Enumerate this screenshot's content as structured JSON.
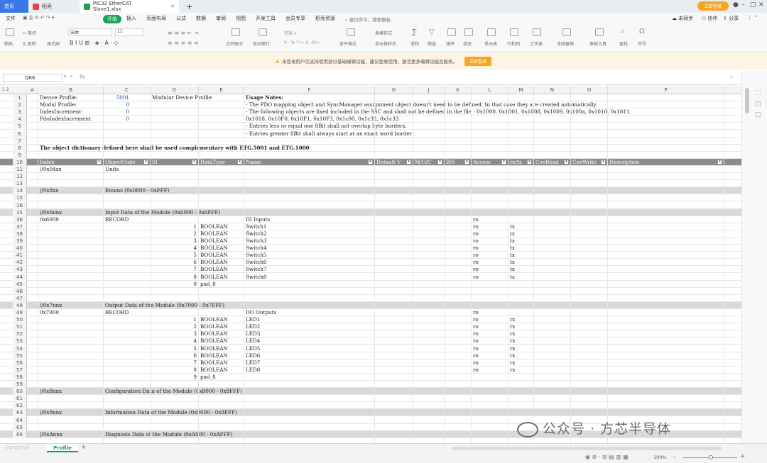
{
  "tabs": {
    "home": "首页",
    "daoke": "稻壳",
    "file": "PIC32 EtherCAT Slave1.xlsx",
    "login": "立即登录"
  },
  "menu": {
    "file": "文件",
    "start": "开始",
    "insert": "插入",
    "page_layout": "页面布局",
    "formula": "公式",
    "data": "数据",
    "review": "审阅",
    "view": "视图",
    "dev_tools": "开发工具",
    "member": "会员专享",
    "resources": "稻壳资源",
    "search": "查找命令、搜索模板",
    "unsynced": "未同步",
    "collab": "协作",
    "share": "分享"
  },
  "ribbon": {
    "paste": "粘贴",
    "cut": "剪切",
    "copy": "复制",
    "format_painter": "格式刷",
    "font": "宋体",
    "font_size": "11",
    "merge_center": "合并居中",
    "auto_wrap": "自动换行",
    "cond_format": "条件格式",
    "table_style": "表格样式",
    "cell_style": "单元格样式",
    "sum": "求和",
    "filter": "筛选",
    "sort": "排序",
    "fill": "填充",
    "cell": "单元格",
    "rowcol": "行和列",
    "worksheet": "工作表",
    "freeze": "冻结窗格",
    "table_tools": "表格工具",
    "find": "查找",
    "symbol": "符号"
  },
  "notice": {
    "text": "未登录用户仅支持使用部分基础编辑功能，建议登录使用，激活更多编辑功能及服务。",
    "button": "立即登录"
  },
  "formula_bar": {
    "name_box": "Q66",
    "fx": "fx"
  },
  "columns": [
    "A",
    "B",
    "C",
    "D",
    "E",
    "F",
    "G",
    "J",
    "K",
    "L",
    "M",
    "N",
    "O",
    "P"
  ],
  "rows": [
    {
      "n": "1",
      "c": {
        "B": "Device Profile:",
        "C": "5001",
        "D": "Modular Device Profile",
        "F": "Usage Notes:"
      }
    },
    {
      "n": "2",
      "c": {
        "B": "Modul Profile:",
        "C": "0",
        "F": "- The PDO mapping object and SyncManager assignment object doesn't need to be defined. In that case they are created automatically."
      }
    },
    {
      "n": "3",
      "c": {
        "B": "IndexIncrement:",
        "C": "0",
        "F": "- The following objects are fixed included in the SSC and shall not be defined in the file : 0x1000, 0x1001, 0x1008, 0x1009, 0x100a, 0x1010, 0x1011,"
      }
    },
    {
      "n": "4",
      "c": {
        "B": "PdoIndexIncrement:",
        "C": "0",
        "F": "0x1018, 0x10F0, 0x10F1, 0x10F3, 0x1c00, 0x1c32, 0x1c33"
      }
    },
    {
      "n": "5",
      "c": {
        "F": "- Entries less or equal one 8Bit shall not overlap byte borders."
      }
    },
    {
      "n": "6",
      "c": {
        "F": "- Entries greater 8Bit shall always start at an exact word border"
      }
    },
    {
      "n": "7",
      "c": {}
    },
    {
      "n": "8",
      "c": {
        "B": "The object dictionary defined here shall be used complementary with ETG.5001 and ETG.1000"
      }
    },
    {
      "n": "9",
      "c": {}
    },
    {
      "n": "10",
      "hdr": true,
      "c": {
        "B": "Index",
        "C": "ObjectCode",
        "D": "SI",
        "E": "DataType",
        "F": "Name",
        "G": "Default V",
        "J": "M/O/C",
        "K": "B/S",
        "L": "Access",
        "M": "rx/tx",
        "N": "CoeRead",
        "O": "CoeWrite",
        "P": "Description"
      }
    },
    {
      "n": "11",
      "c": {
        "B": "//0x04xx",
        "C": "Units"
      }
    },
    {
      "n": "12",
      "c": {}
    },
    {
      "n": "13",
      "c": {}
    },
    {
      "n": "14",
      "band": true,
      "c": {
        "B": "//0x8xx",
        "C": "Enums (0x0800 - 0xFFF)"
      }
    },
    {
      "n": "15",
      "c": {}
    },
    {
      "n": "16",
      "c": {}
    },
    {
      "n": "35",
      "band": true,
      "c": {
        "B": "//0x6nnx",
        "C": "Input Data of the Module (0x6000 - 0x6FFF)"
      }
    },
    {
      "n": "36",
      "c": {
        "B": "0x6000",
        "C": "RECORD",
        "F": "DI Inputs",
        "L": "ro"
      }
    },
    {
      "n": "37",
      "c": {
        "D": "1",
        "E": "BOOLEAN",
        "F": "Switch1",
        "L": "ro",
        "M": "tx"
      }
    },
    {
      "n": "38",
      "c": {
        "D": "2",
        "E": "BOOLEAN",
        "F": "Switch2",
        "L": "ro",
        "M": "tx"
      }
    },
    {
      "n": "39",
      "c": {
        "D": "3",
        "E": "BOOLEAN",
        "F": "Switch3",
        "L": "ro",
        "M": "tx"
      }
    },
    {
      "n": "40",
      "c": {
        "D": "4",
        "E": "BOOLEAN",
        "F": "Switch4",
        "L": "ro",
        "M": "tx"
      }
    },
    {
      "n": "41",
      "c": {
        "D": "5",
        "E": "BOOLEAN",
        "F": "Switch5",
        "L": "ro",
        "M": "tx"
      }
    },
    {
      "n": "42",
      "c": {
        "D": "6",
        "E": "BOOLEAN",
        "F": "Switch6",
        "L": "ro",
        "M": "tx"
      }
    },
    {
      "n": "43",
      "c": {
        "D": "7",
        "E": "BOOLEAN",
        "F": "Switch7",
        "L": "ro",
        "M": "tx"
      }
    },
    {
      "n": "44",
      "c": {
        "D": "8",
        "E": "BOOLEAN",
        "F": "Switch8",
        "L": "ro",
        "M": "tx"
      }
    },
    {
      "n": "45",
      "c": {
        "D": "9",
        "E": "pad_8"
      }
    },
    {
      "n": "46",
      "c": {}
    },
    {
      "n": "47",
      "c": {}
    },
    {
      "n": "48",
      "band": true,
      "c": {
        "B": "//0x7nnx",
        "C": "Output Data of the Module (0x7000 - 0x7FFF)"
      }
    },
    {
      "n": "49",
      "c": {
        "B": "0x7000",
        "C": "RECORD",
        "F": "DO Outputs",
        "L": "ro"
      }
    },
    {
      "n": "50",
      "c": {
        "D": "1",
        "E": "BOOLEAN",
        "F": "LED1",
        "L": "ro",
        "M": "rx"
      }
    },
    {
      "n": "51",
      "c": {
        "D": "2",
        "E": "BOOLEAN",
        "F": "LED2",
        "L": "ro",
        "M": "rx"
      }
    },
    {
      "n": "52",
      "c": {
        "D": "3",
        "E": "BOOLEAN",
        "F": "LED3",
        "L": "ro",
        "M": "rx"
      }
    },
    {
      "n": "53",
      "c": {
        "D": "4",
        "E": "BOOLEAN",
        "F": "LED4",
        "L": "ro",
        "M": "rx"
      }
    },
    {
      "n": "54",
      "c": {
        "D": "5",
        "E": "BOOLEAN",
        "F": "LED5",
        "L": "ro",
        "M": "rx"
      }
    },
    {
      "n": "55",
      "c": {
        "D": "6",
        "E": "BOOLEAN",
        "F": "LED6",
        "L": "ro",
        "M": "rx"
      }
    },
    {
      "n": "56",
      "c": {
        "D": "7",
        "E": "BOOLEAN",
        "F": "LED7",
        "L": "ro",
        "M": "rx"
      }
    },
    {
      "n": "57",
      "c": {
        "D": "8",
        "E": "BOOLEAN",
        "F": "LED8",
        "L": "ro",
        "M": "rx"
      }
    },
    {
      "n": "58",
      "c": {
        "D": "9",
        "E": "pad_8"
      }
    },
    {
      "n": "59",
      "c": {}
    },
    {
      "n": "60",
      "band": true,
      "c": {
        "B": "//0x8nnx",
        "C": "Configuration Data of the Module (0x8000 - 0x8FFF)"
      }
    },
    {
      "n": "61",
      "c": {}
    },
    {
      "n": "62",
      "c": {}
    },
    {
      "n": "63",
      "band": true,
      "c": {
        "B": "//0x9nnx",
        "C": "Information Data of the Module (0x9000 - 0x9FFF)"
      }
    },
    {
      "n": "64",
      "c": {}
    },
    {
      "n": "65",
      "c": {}
    },
    {
      "n": "66",
      "band": true,
      "c": {
        "B": "//0xAnnx",
        "C": "Diagnosis Data of the Module (0xA000 - 0xAFFF)"
      }
    }
  ],
  "sheet_tabs": {
    "active": "Profile",
    "add": "+"
  },
  "status": {
    "zoom": "100%"
  },
  "watermark": "公众号 · 方芯半导体"
}
